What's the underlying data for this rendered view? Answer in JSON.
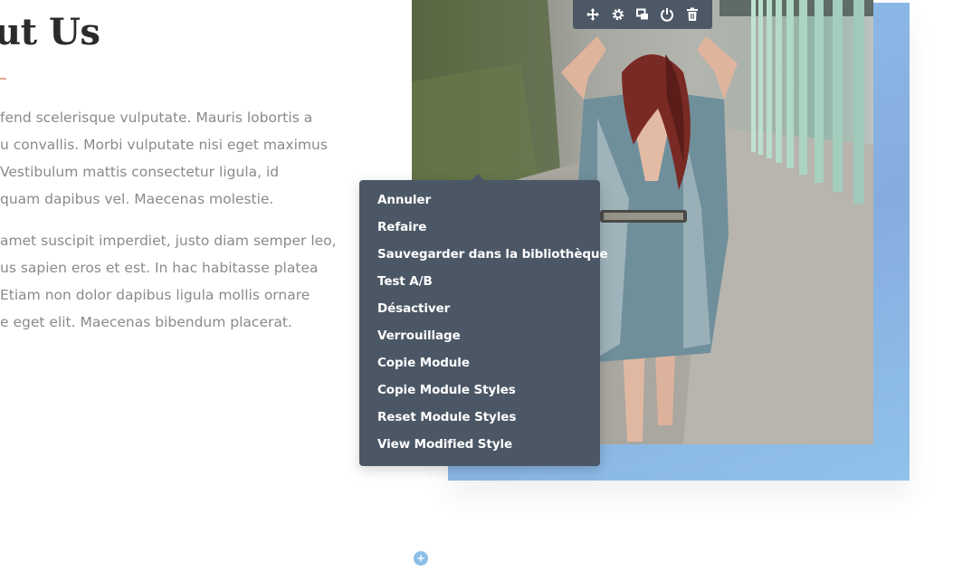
{
  "section": {
    "heading": "ut Us",
    "paragraphs": [
      {
        "lines": [
          "fend scelerisque vulputate. Mauris lobortis a",
          "u convallis. Morbi vulputate nisi eget maximus",
          " Vestibulum mattis consectetur ligula, id",
          "quam dapibus vel. Maecenas molestie."
        ]
      },
      {
        "lines": [
          "amet suscipit imperdiet, justo diam semper leo,",
          "us sapien eros et est. In hac habitasse platea",
          " Etiam non dolor dapibus ligula mollis ornare",
          "e eget elit. Maecenas bibendum placerat."
        ]
      }
    ]
  },
  "toolbar": {
    "buttons": [
      {
        "name": "move",
        "icon": "move-icon"
      },
      {
        "name": "settings",
        "icon": "gear-icon"
      },
      {
        "name": "duplicate",
        "icon": "duplicate-icon"
      },
      {
        "name": "disable",
        "icon": "power-icon"
      },
      {
        "name": "delete",
        "icon": "trash-icon"
      }
    ]
  },
  "context_menu": {
    "items": [
      "Annuler",
      "Refaire",
      "Sauvegarder dans la bibliothèque",
      "Test A/B",
      "Désactiver",
      "Verrouillage",
      "Copie Module",
      "Copie Module Styles",
      "Reset Module Styles",
      "View Modified Style"
    ]
  },
  "add_button": {
    "icon": "plus-icon"
  },
  "colors": {
    "menu_background": "#4c5766",
    "toolbar_background": "#4c5866",
    "accent_rule": "#e2a98d",
    "backdrop_blue": "#86acdf",
    "add_button": "#8cbfe8",
    "heading": "#2b2b2b",
    "body_text": "#8a8a8a"
  }
}
